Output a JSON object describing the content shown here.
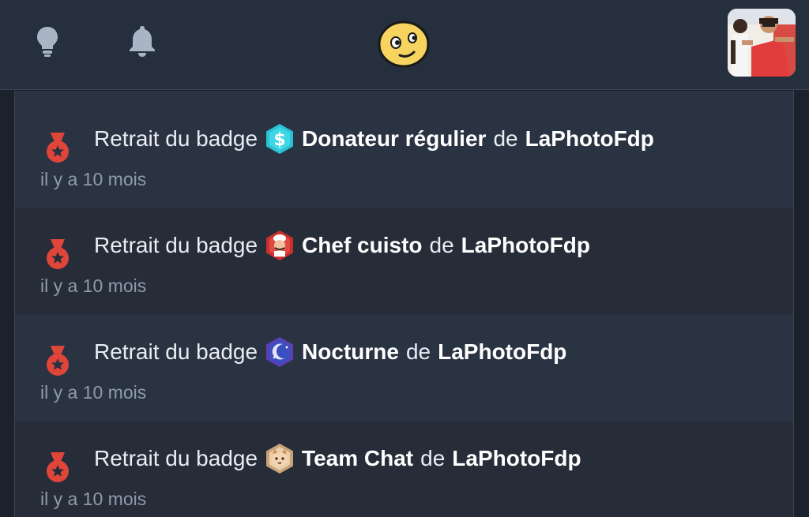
{
  "header": {
    "icons": [
      "lightbulb-icon",
      "bell-icon",
      "smirk-emoji",
      "user-avatar"
    ]
  },
  "notifications": [
    {
      "prefix": "Retrait du badge",
      "badge_name": "Donateur régulier",
      "badge_icon": "dollar-hexagon-icon",
      "connector": "de",
      "user": "LaPhotoFdp",
      "time": "il y a 10 mois"
    },
    {
      "prefix": "Retrait du badge",
      "badge_name": "Chef cuisto",
      "badge_icon": "chef-hexagon-icon",
      "connector": "de",
      "user": "LaPhotoFdp",
      "time": "il y a 10 mois"
    },
    {
      "prefix": "Retrait du badge",
      "badge_name": "Nocturne",
      "badge_icon": "moon-hexagon-icon",
      "connector": "de",
      "user": "LaPhotoFdp",
      "time": "il y a 10 mois"
    },
    {
      "prefix": "Retrait du badge",
      "badge_name": "Team Chat",
      "badge_icon": "cat-hexagon-icon",
      "connector": "de",
      "user": "LaPhotoFdp",
      "time": "il y a 10 mois"
    }
  ],
  "colors": {
    "header_bg": "#252f3e",
    "list_bg": "#2a3342",
    "list_alt_bg": "#262d39",
    "medal_red": "#e0453a",
    "muted_text": "#8f9aab"
  }
}
